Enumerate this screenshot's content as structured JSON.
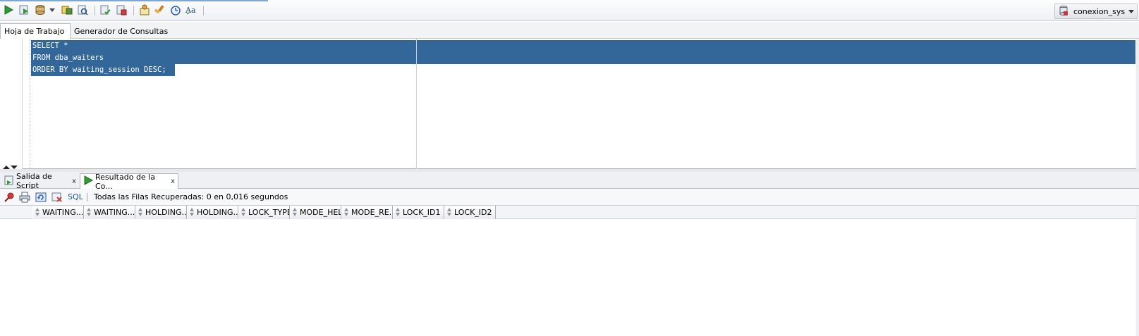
{
  "toolbar": {
    "connection_label": "conexion_sys",
    "icons": [
      "run-statement-icon",
      "run-script-icon",
      "commit-icon",
      "dropdown-arrow-icon",
      "explain-plan-icon",
      "autotrace-icon",
      "rollback-icon",
      "cancel-icon",
      "sql-tuning-icon",
      "clear-icon",
      "history-icon",
      "format-icon"
    ]
  },
  "worksheet_tabs": [
    {
      "label": "Hoja de Trabajo",
      "active": true
    },
    {
      "label": "Generador de Consultas",
      "active": false
    }
  ],
  "editor": {
    "lines": [
      "SELECT *",
      "FROM dba_waiters",
      "ORDER BY waiting_session DESC;"
    ]
  },
  "result_tabs": [
    {
      "label": "Salida de Script",
      "close": "x",
      "active": false
    },
    {
      "label": "Resultado de la Co...",
      "close": "x",
      "active": true
    }
  ],
  "result_toolbar": {
    "sql_label": "SQL",
    "status": "Todas las Filas Recuperadas: 0 en 0,016 segundos"
  },
  "grid": {
    "columns": [
      "WAITING...",
      "WAITING...",
      "HOLDING...",
      "HOLDING...",
      "LOCK_TYPE",
      "MODE_HELD",
      "MODE_RE...",
      "LOCK_ID1",
      "LOCK_ID2"
    ],
    "rows": []
  },
  "colors": {
    "selection": "#336699",
    "accent_green": "#2f9b32",
    "link_blue": "#1e4f9c"
  }
}
